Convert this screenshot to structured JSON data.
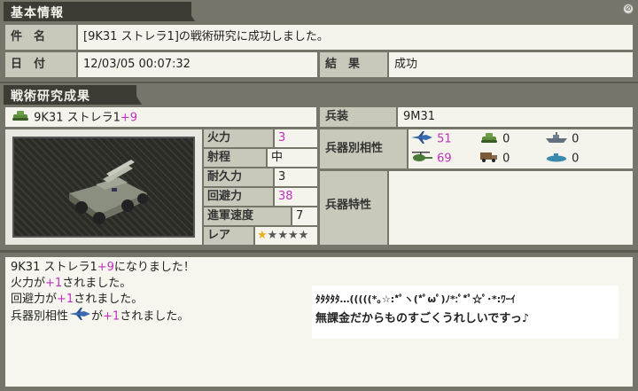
{
  "section1": {
    "title": "基本情報"
  },
  "basic": {
    "name_label": "件　名",
    "name_value": "[9K31 ストレラ1]の戦術研究に成功しました。",
    "date_label": "日　付",
    "date_value": "12/03/05 00:07:32",
    "result_label": "結　果",
    "result_value": "成功"
  },
  "section2": {
    "title": "戦術研究成果"
  },
  "unit": {
    "name": "9K31 ストレラ1",
    "plus": "+9",
    "icon": "tank-icon"
  },
  "stats": [
    {
      "label": "火力",
      "value": "3",
      "highlight": true
    },
    {
      "label": "射程",
      "value": "中",
      "highlight": false
    },
    {
      "label": "耐久力",
      "value": "3",
      "highlight": false
    },
    {
      "label": "回避力",
      "value": "38",
      "highlight": true
    },
    {
      "label": "進軍速度",
      "value": "7",
      "highlight": false
    },
    {
      "label": "レア",
      "value": "",
      "highlight": false
    }
  ],
  "rarity": {
    "filled": 1,
    "total": 5
  },
  "weapon": {
    "label": "兵装",
    "value": "9M31"
  },
  "affinity": {
    "label": "兵器別相性",
    "items": [
      {
        "icon": "jet-fighter-icon",
        "value": "51",
        "highlight": true
      },
      {
        "icon": "tank-icon",
        "value": "0",
        "highlight": false
      },
      {
        "icon": "battleship-icon",
        "value": "0",
        "highlight": false
      },
      {
        "icon": "helicopter-icon",
        "value": "69",
        "highlight": true
      },
      {
        "icon": "truck-icon",
        "value": "0",
        "highlight": false
      },
      {
        "icon": "submarine-icon",
        "value": "0",
        "highlight": false
      }
    ]
  },
  "traits": {
    "label": "兵器特性",
    "value": ""
  },
  "messages": {
    "line1_a": "9K31 ストレラ1",
    "line1_plus": "+9",
    "line1_b": "になりました！",
    "line2_a": "火力が",
    "line2_plus": "+1",
    "line2_b": "されました。",
    "line3_a": "回避力が",
    "line3_plus": "+1",
    "line3_b": "されました。",
    "line4_a": "兵器別相性",
    "line4_b": "が",
    "line4_plus": "+1",
    "line4_c": "されました。"
  },
  "overlay": {
    "line1": "ﾀﾀﾀﾀﾀ…(((((*｡☆:*ﾟヽ(*ﾟωﾟ)ﾉ*:ﾟ*ﾟ☆ﾟ･*:ﾜｰｲ",
    "line2": "無課金だからものすごくうれしいですっ♪"
  },
  "colors": {
    "highlight": "#c030c0",
    "star_filled": "#e8b020",
    "star_empty": "#555555"
  }
}
